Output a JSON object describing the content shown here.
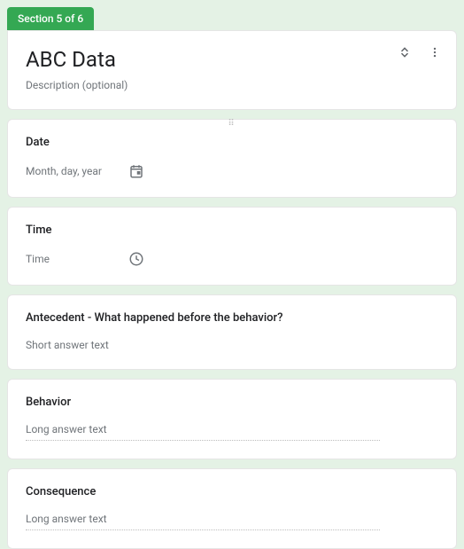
{
  "section": {
    "badge": "Section 5 of 6",
    "title": "ABC Data",
    "description": "Description (optional)"
  },
  "questions": {
    "date": {
      "title": "Date",
      "placeholder": "Month, day, year"
    },
    "time": {
      "title": "Time",
      "placeholder": "Time"
    },
    "antecedent": {
      "title": "Antecedent - What happened before the behavior?",
      "hint": "Short answer text"
    },
    "behavior": {
      "title": "Behavior",
      "hint": "Long answer text"
    },
    "consequence": {
      "title": "Consequence",
      "hint": "Long answer text"
    }
  }
}
